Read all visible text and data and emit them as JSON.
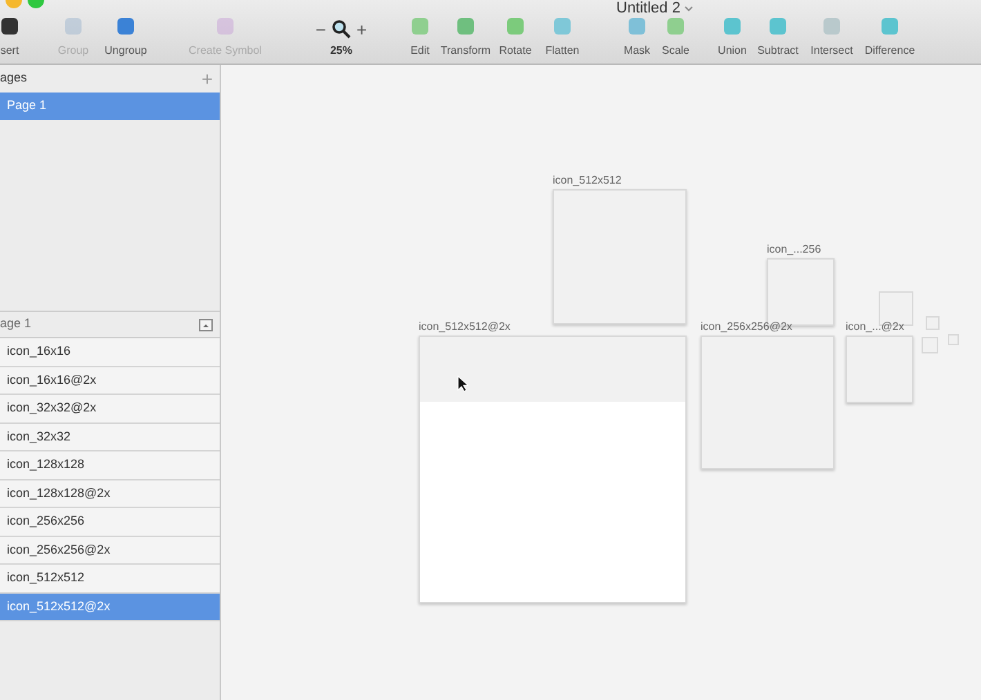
{
  "window": {
    "title": "Untitled 2"
  },
  "toolbar": {
    "groups": [
      [
        {
          "label": "sert",
          "disabled": false
        }
      ],
      [
        {
          "label": "Group",
          "disabled": true
        },
        {
          "label": "Ungroup",
          "disabled": false
        }
      ],
      [
        {
          "label": "Create Symbol",
          "disabled": true
        }
      ],
      [
        {
          "label": "Edit",
          "disabled": false
        },
        {
          "label": "Transform",
          "disabled": false
        },
        {
          "label": "Rotate",
          "disabled": false
        },
        {
          "label": "Flatten",
          "disabled": false
        }
      ],
      [
        {
          "label": "Mask",
          "disabled": false
        },
        {
          "label": "Scale",
          "disabled": false
        }
      ],
      [
        {
          "label": "Union",
          "disabled": false
        },
        {
          "label": "Subtract",
          "disabled": false
        },
        {
          "label": "Intersect",
          "disabled": false
        },
        {
          "label": "Difference",
          "disabled": false
        }
      ]
    ],
    "zoom": {
      "minus": "−",
      "plus": "+",
      "value": "25%"
    }
  },
  "pages": {
    "title": "ages",
    "add": "+",
    "items": [
      {
        "label": "Page 1",
        "selected": true
      }
    ]
  },
  "layers": {
    "title": "age 1",
    "items": [
      {
        "label": "icon_16x16",
        "selected": false
      },
      {
        "label": "icon_16x16@2x",
        "selected": false
      },
      {
        "label": "icon_32x32@2x",
        "selected": false
      },
      {
        "label": "icon_32x32",
        "selected": false
      },
      {
        "label": "icon_128x128",
        "selected": false
      },
      {
        "label": "icon_128x128@2x",
        "selected": false
      },
      {
        "label": "icon_256x256",
        "selected": false
      },
      {
        "label": "icon_256x256@2x",
        "selected": false
      },
      {
        "label": "icon_512x512",
        "selected": false
      },
      {
        "label": "icon_512x512@2x",
        "selected": true
      }
    ]
  },
  "canvas": {
    "artboards": [
      {
        "label": "icon_512x512"
      },
      {
        "label": "icon_...256"
      },
      {
        "label": "icon_512x512@2x"
      },
      {
        "label": "icon_256x256@2x"
      },
      {
        "label": "icon_...@2x"
      }
    ]
  }
}
